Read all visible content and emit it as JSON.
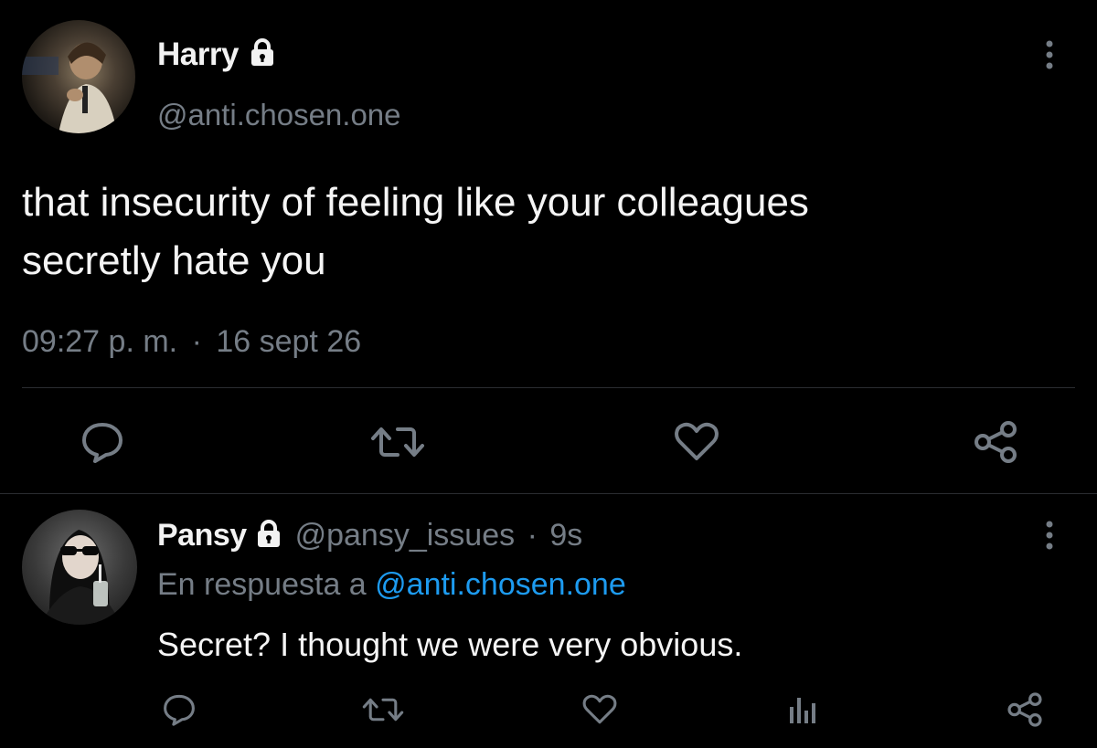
{
  "main_tweet": {
    "author_name": "Harry",
    "handle": "@anti.chosen.one",
    "text_line1": "that insecurity of feeling like your colleagues",
    "text_line2": "secretly hate you",
    "time": "09:27 p. m.",
    "separator": "·",
    "date": "16 sept 26",
    "actions": [
      "reply-icon",
      "retweet-icon",
      "like-icon",
      "share-icon"
    ]
  },
  "reply_tweet": {
    "author_name": "Pansy",
    "handle": "@pansy_issues",
    "separator": "·",
    "age": "9s",
    "reply_prefix": "En respuesta a",
    "reply_to": "@anti.chosen.one",
    "text": "Secret? I thought we were very obvious.",
    "actions": [
      "reply-icon",
      "retweet-icon",
      "like-icon",
      "analytics-icon",
      "share-icon"
    ]
  },
  "colors": {
    "background": "#000000",
    "muted": "#757d86",
    "link": "#1d9bf0",
    "divider": "#2a2d31"
  }
}
